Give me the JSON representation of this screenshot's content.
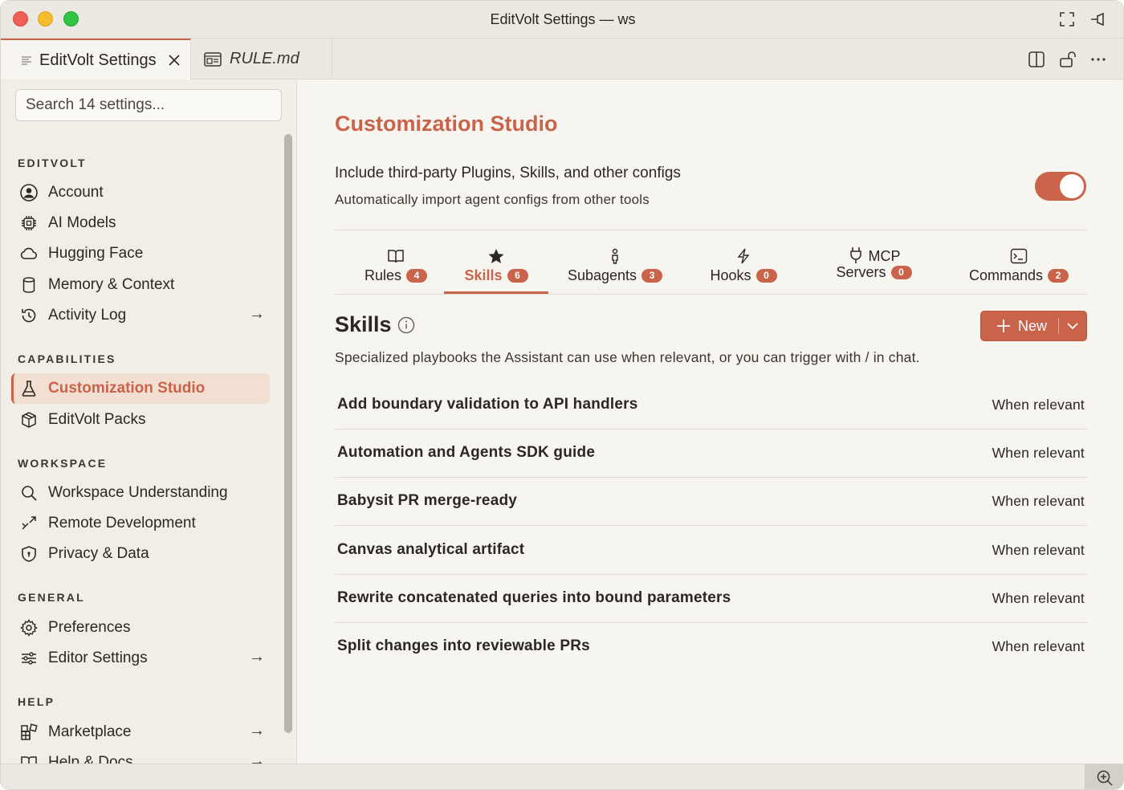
{
  "window": {
    "title": "EditVolt Settings — ws"
  },
  "tabs": [
    {
      "label": "EditVolt Settings",
      "icon": "list-icon",
      "active": true
    },
    {
      "label": "RULE.md",
      "icon": "preview-icon",
      "active": false
    }
  ],
  "sidebar": {
    "search_placeholder": "Search 14 settings...",
    "sections": [
      {
        "title": "EDITVOLT",
        "items": [
          {
            "label": "Account",
            "icon": "account-icon"
          },
          {
            "label": "AI Models",
            "icon": "chip-icon"
          },
          {
            "label": "Hugging Face",
            "icon": "cloud-icon"
          },
          {
            "label": "Memory & Context",
            "icon": "database-icon"
          },
          {
            "label": "Activity Log",
            "icon": "history-icon",
            "arrow": "→"
          }
        ]
      },
      {
        "title": "CAPABILITIES",
        "items": [
          {
            "label": "Customization Studio",
            "icon": "flask-icon",
            "active": true
          },
          {
            "label": "EditVolt Packs",
            "icon": "package-icon"
          }
        ]
      },
      {
        "title": "WORKSPACE",
        "items": [
          {
            "label": "Workspace Understanding",
            "icon": "search-icon"
          },
          {
            "label": "Remote Development",
            "icon": "remote-icon"
          },
          {
            "label": "Privacy & Data",
            "icon": "shield-icon"
          }
        ]
      },
      {
        "title": "GENERAL",
        "items": [
          {
            "label": "Preferences",
            "icon": "gear-icon"
          },
          {
            "label": "Editor Settings",
            "icon": "sliders-icon",
            "arrow": "→"
          }
        ]
      },
      {
        "title": "HELP",
        "items": [
          {
            "label": "Marketplace",
            "icon": "extensions-icon",
            "arrow": "→"
          },
          {
            "label": "Help & Docs",
            "icon": "book-icon",
            "arrow": "→"
          }
        ]
      }
    ]
  },
  "main": {
    "title": "Customization Studio",
    "option": {
      "title": "Include third-party Plugins, Skills, and other configs",
      "description": "Automatically import agent configs from other tools",
      "enabled": true
    },
    "tabs": [
      {
        "label": "Rules",
        "count": "4",
        "icon": "book-icon"
      },
      {
        "label": "Skills",
        "count": "6",
        "icon": "star-icon",
        "active": true
      },
      {
        "label": "Subagents",
        "count": "3",
        "icon": "person-icon"
      },
      {
        "label": "Hooks",
        "count": "0",
        "icon": "bolt-icon"
      },
      {
        "label": "MCP\nServers",
        "label1": "MCP",
        "label2": "Servers",
        "count": "0",
        "icon": "plug-icon"
      },
      {
        "label": "Commands",
        "count": "2",
        "icon": "terminal-icon"
      }
    ],
    "skills": {
      "heading": "Skills",
      "new_label": "New",
      "description": "Specialized playbooks the Assistant can use when relevant, or you can trigger with / in chat.",
      "items": [
        {
          "name": "Add boundary validation to API handlers",
          "mode": "When relevant"
        },
        {
          "name": "Automation and Agents SDK guide",
          "mode": "When relevant"
        },
        {
          "name": "Babysit PR merge-ready",
          "mode": "When relevant"
        },
        {
          "name": "Canvas analytical artifact",
          "mode": "When relevant"
        },
        {
          "name": "Rewrite concatenated queries into bound parameters",
          "mode": "When relevant"
        },
        {
          "name": "Split changes into reviewable PRs",
          "mode": "When relevant"
        }
      ]
    }
  },
  "colors": {
    "accent": "#c9634a",
    "background": "#f7f5f0",
    "sidebar": "#f1eee8"
  }
}
